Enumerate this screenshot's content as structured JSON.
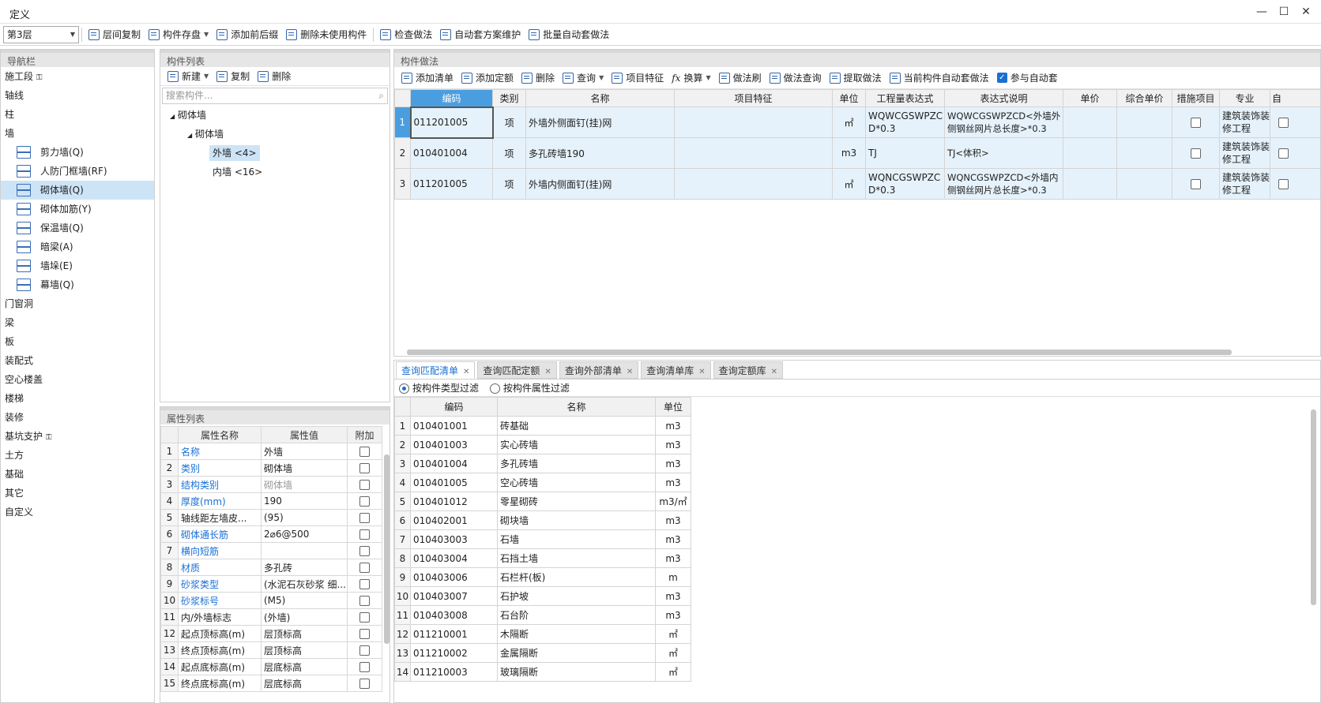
{
  "window": {
    "title": "定义",
    "min": "—",
    "max": "☐",
    "close": "✕"
  },
  "toolbar": {
    "floor": "第3层",
    "items": [
      "层间复制",
      "构件存盘",
      "添加前后缀",
      "删除未使用构件",
      "检查做法",
      "自动套方案维护",
      "批量自动套做法"
    ]
  },
  "nav": {
    "title": "导航栏",
    "items_top": [
      "施工段",
      "轴线",
      "柱",
      "墙"
    ],
    "wall_subs": [
      "剪力墙(Q)",
      "人防门框墙(RF)",
      "砌体墙(Q)",
      "砌体加筋(Y)",
      "保温墙(Q)",
      "暗梁(A)",
      "墙垛(E)",
      "幕墙(Q)"
    ],
    "items_bottom": [
      "门窗洞",
      "梁",
      "板",
      "装配式",
      "空心楼盖",
      "楼梯",
      "装修",
      "基坑支护",
      "土方",
      "基础",
      "其它",
      "自定义"
    ]
  },
  "complist": {
    "title": "构件列表",
    "new": "新建",
    "copy": "复制",
    "del": "删除",
    "search_placeholder": "搜索构件...",
    "tree": [
      "砌体墙",
      "砌体墙",
      "外墙 <4>",
      "内墙 <16>"
    ]
  },
  "props": {
    "title": "属性列表",
    "headers": [
      "属性名称",
      "属性值",
      "附加"
    ],
    "rows": [
      {
        "n": "1",
        "name": "名称",
        "val": "外墙",
        "blue": true
      },
      {
        "n": "2",
        "name": "类别",
        "val": "砌体墙",
        "blue": true
      },
      {
        "n": "3",
        "name": "结构类别",
        "val": "砌体墙",
        "blue": true,
        "gray": true
      },
      {
        "n": "4",
        "name": "厚度(mm)",
        "val": "190",
        "blue": true
      },
      {
        "n": "5",
        "name": "轴线距左墙皮...",
        "val": "(95)",
        "blue": false
      },
      {
        "n": "6",
        "name": "砌体通长筋",
        "val": "2⌀6@500",
        "blue": true
      },
      {
        "n": "7",
        "name": "横向短筋",
        "val": "",
        "blue": true
      },
      {
        "n": "8",
        "name": "材质",
        "val": "多孔砖",
        "blue": true
      },
      {
        "n": "9",
        "name": "砂浆类型",
        "val": "(水泥石灰砂浆 细...",
        "blue": true
      },
      {
        "n": "10",
        "name": "砂浆标号",
        "val": "(M5)",
        "blue": true
      },
      {
        "n": "11",
        "name": "内/外墙标志",
        "val": "(外墙)",
        "blue": false
      },
      {
        "n": "12",
        "name": "起点顶标高(m)",
        "val": "层顶标高",
        "blue": false
      },
      {
        "n": "13",
        "name": "终点顶标高(m)",
        "val": "层顶标高",
        "blue": false
      },
      {
        "n": "14",
        "name": "起点底标高(m)",
        "val": "层底标高",
        "blue": false
      },
      {
        "n": "15",
        "name": "终点底标高(m)",
        "val": "层底标高",
        "blue": false
      }
    ]
  },
  "method": {
    "title": "构件做法",
    "tools": [
      "添加清单",
      "添加定额",
      "删除",
      "查询",
      "项目特征",
      "换算",
      "做法刷",
      "做法查询",
      "提取做法",
      "当前构件自动套做法",
      "参与自动套"
    ],
    "headers": [
      "编码",
      "类别",
      "名称",
      "项目特征",
      "单位",
      "工程量表达式",
      "表达式说明",
      "单价",
      "综合单价",
      "措施项目",
      "专业",
      "自"
    ],
    "rows": [
      {
        "n": "1",
        "code": "011201005",
        "type": "项",
        "name": "外墙外侧面钉(挂)网",
        "feat": "",
        "unit": "㎡",
        "expr": "WQWCGSWPZCD*0.3",
        "desc": "WQWCGSWPZCD<外墙外侧钢丝网片总长度>*0.3",
        "major": "建筑装饰装修工程"
      },
      {
        "n": "2",
        "code": "010401004",
        "type": "项",
        "name": "多孔砖墙190",
        "feat": "",
        "unit": "m3",
        "expr": "TJ",
        "desc": "TJ<体积>",
        "major": "建筑装饰装修工程"
      },
      {
        "n": "3",
        "code": "011201005",
        "type": "项",
        "name": "外墙内侧面钉(挂)网",
        "feat": "",
        "unit": "㎡",
        "expr": "WQNCGSWPZCD*0.3",
        "desc": "WQNCGSWPZCD<外墙内侧钢丝网片总长度>*0.3",
        "major": "建筑装饰装修工程"
      }
    ]
  },
  "query": {
    "tabs": [
      "查询匹配清单",
      "查询匹配定额",
      "查询外部清单",
      "查询清单库",
      "查询定额库"
    ],
    "filter1": "按构件类型过滤",
    "filter2": "按构件属性过滤",
    "headers": [
      "编码",
      "名称",
      "单位"
    ],
    "rows": [
      {
        "n": "1",
        "code": "010401001",
        "name": "砖基础",
        "unit": "m3"
      },
      {
        "n": "2",
        "code": "010401003",
        "name": "实心砖墙",
        "unit": "m3"
      },
      {
        "n": "3",
        "code": "010401004",
        "name": "多孔砖墙",
        "unit": "m3"
      },
      {
        "n": "4",
        "code": "010401005",
        "name": "空心砖墙",
        "unit": "m3"
      },
      {
        "n": "5",
        "code": "010401012",
        "name": "零星砌砖",
        "unit": "m3/㎡"
      },
      {
        "n": "6",
        "code": "010402001",
        "name": "砌块墙",
        "unit": "m3"
      },
      {
        "n": "7",
        "code": "010403003",
        "name": "石墙",
        "unit": "m3"
      },
      {
        "n": "8",
        "code": "010403004",
        "name": "石挡土墙",
        "unit": "m3"
      },
      {
        "n": "9",
        "code": "010403006",
        "name": "石栏杆(板)",
        "unit": "m"
      },
      {
        "n": "10",
        "code": "010403007",
        "name": "石护坡",
        "unit": "m3"
      },
      {
        "n": "11",
        "code": "010403008",
        "name": "石台阶",
        "unit": "m3"
      },
      {
        "n": "12",
        "code": "011210001",
        "name": "木隔断",
        "unit": "㎡"
      },
      {
        "n": "13",
        "code": "011210002",
        "name": "金属隔断",
        "unit": "㎡"
      },
      {
        "n": "14",
        "code": "011210003",
        "name": "玻璃隔断",
        "unit": "㎡"
      }
    ]
  }
}
